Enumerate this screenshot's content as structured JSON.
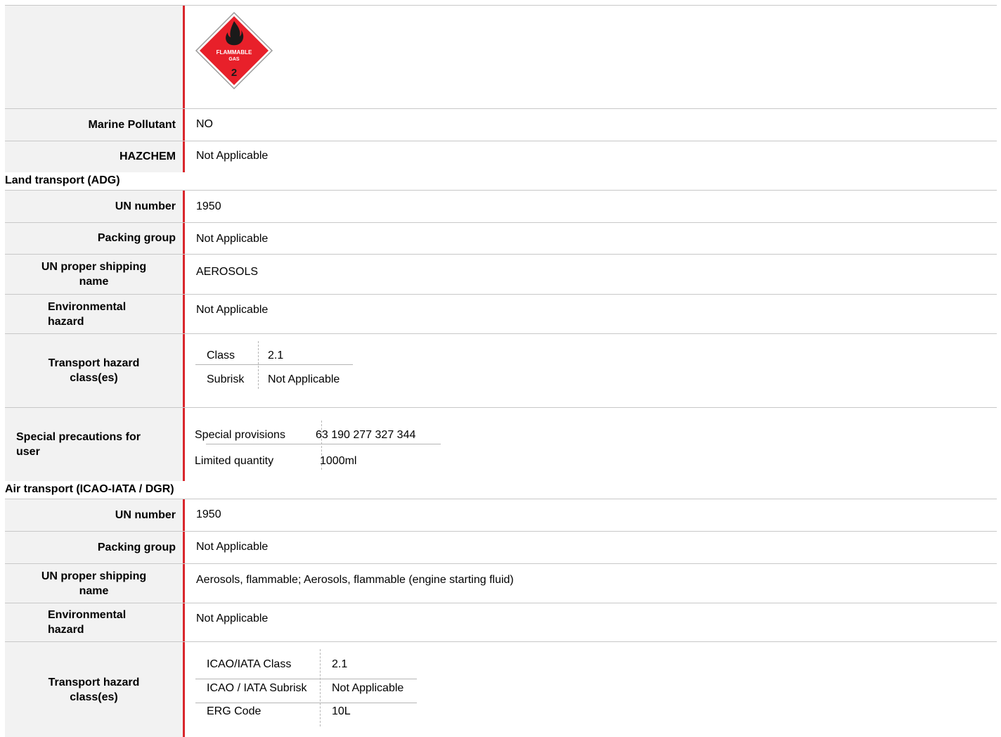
{
  "placard": {
    "line1": "FLAMMABLE",
    "line2": "GAS",
    "class_num": "2"
  },
  "top": [
    {
      "label": "Marine Pollutant",
      "value": "NO"
    },
    {
      "label": "HAZCHEM",
      "value": "Not Applicable"
    }
  ],
  "land": {
    "heading": "Land transport (ADG)",
    "un_number": {
      "label": "UN number",
      "value": "1950"
    },
    "packing_group": {
      "label": "Packing group",
      "value": "Not Applicable"
    },
    "shipping_name": {
      "label": "UN proper shipping name",
      "value": "AEROSOLS"
    },
    "env_hazard": {
      "label": "Environmental hazard",
      "value": "Not Applicable"
    },
    "hazard_class": {
      "label": "Transport hazard class(es)",
      "rows": [
        {
          "key": "Class",
          "value": "2.1"
        },
        {
          "key": "Subrisk",
          "value": "Not Applicable"
        }
      ]
    },
    "special": {
      "label": "Special precautions for user",
      "rows": [
        {
          "key": "Special provisions",
          "value": "63 190 277 327 344"
        },
        {
          "key": "Limited quantity",
          "value": "1000ml"
        }
      ]
    }
  },
  "air": {
    "heading": "Air transport (ICAO-IATA / DGR)",
    "un_number": {
      "label": "UN number",
      "value": "1950"
    },
    "packing_group": {
      "label": "Packing group",
      "value": "Not Applicable"
    },
    "shipping_name": {
      "label": "UN proper shipping name",
      "value": "Aerosols, flammable; Aerosols, flammable (engine starting fluid)"
    },
    "env_hazard": {
      "label": "Environmental hazard",
      "value": "Not Applicable"
    },
    "hazard_class": {
      "label": "Transport hazard class(es)",
      "rows": [
        {
          "key": "ICAO/IATA Class",
          "value": "2.1"
        },
        {
          "key": "ICAO / IATA Subrisk",
          "value": "Not Applicable"
        },
        {
          "key": "ERG Code",
          "value": "10L"
        }
      ]
    }
  },
  "colors": {
    "accent_bar": "#d9262c",
    "placard_red": "#e8202a",
    "label_bg": "#f2f2f2"
  }
}
